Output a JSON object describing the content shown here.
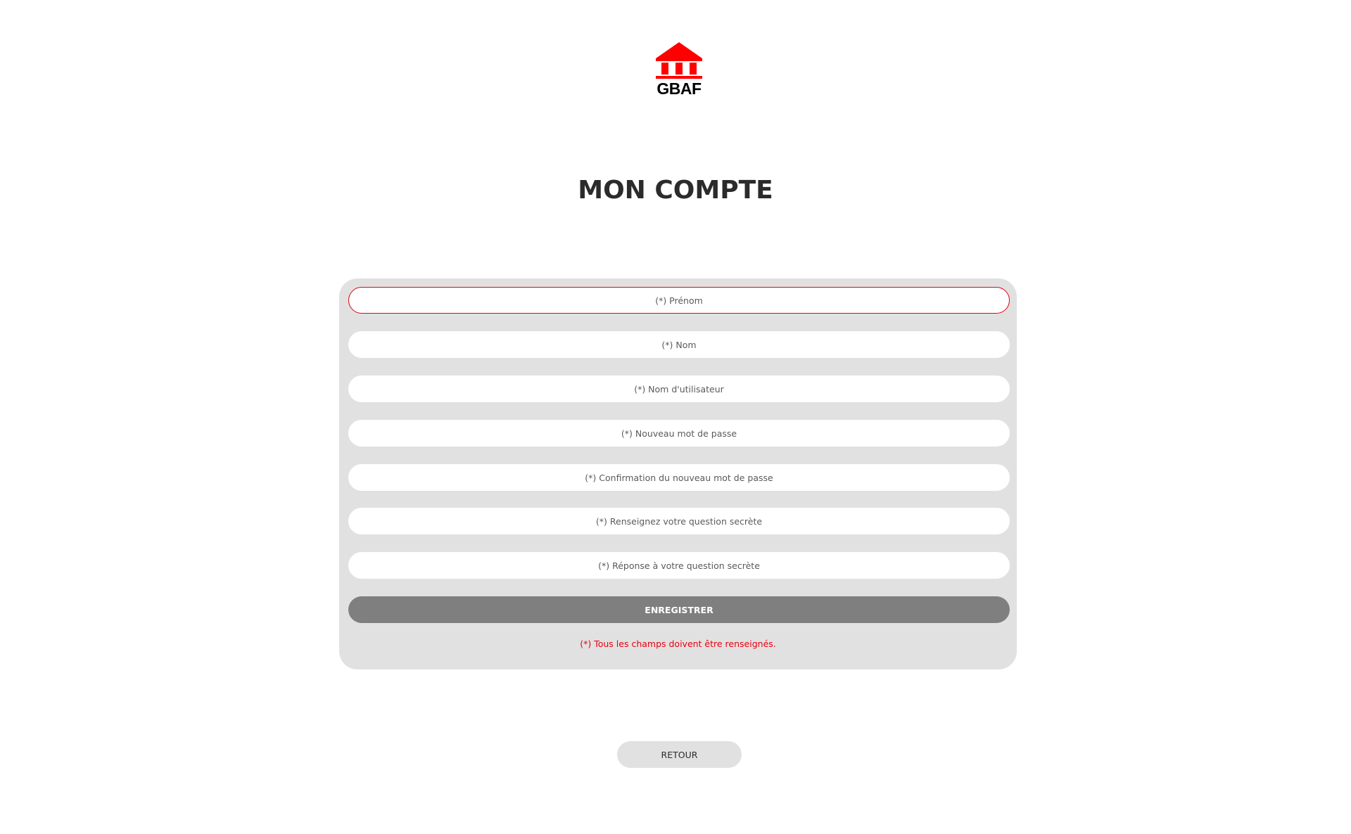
{
  "logo": {
    "text": "GBAF",
    "icon": "bank-building-icon",
    "color": "#ff0000"
  },
  "header": {
    "title": "MON COMPTE"
  },
  "form": {
    "fields": [
      {
        "placeholder": "(*) Prénom",
        "value": "",
        "focused": true
      },
      {
        "placeholder": "(*) Nom",
        "value": ""
      },
      {
        "placeholder": "(*) Nom d'utilisateur",
        "value": ""
      },
      {
        "placeholder": "(*) Nouveau mot de passe",
        "value": ""
      },
      {
        "placeholder": "(*) Confirmation du nouveau mot de passe",
        "value": ""
      },
      {
        "placeholder": "(*) Renseignez votre question secrète",
        "value": ""
      },
      {
        "placeholder": "(*) Réponse à votre question secrète",
        "value": ""
      }
    ],
    "submit_label": "ENREGISTRER",
    "required_note": "(*) Tous les champs doivent être renseignés."
  },
  "footer": {
    "back_label": "RETOUR"
  },
  "colors": {
    "accent": "#e8000f",
    "card_background": "#e1e1e1",
    "button_background": "#7f7f7f"
  }
}
